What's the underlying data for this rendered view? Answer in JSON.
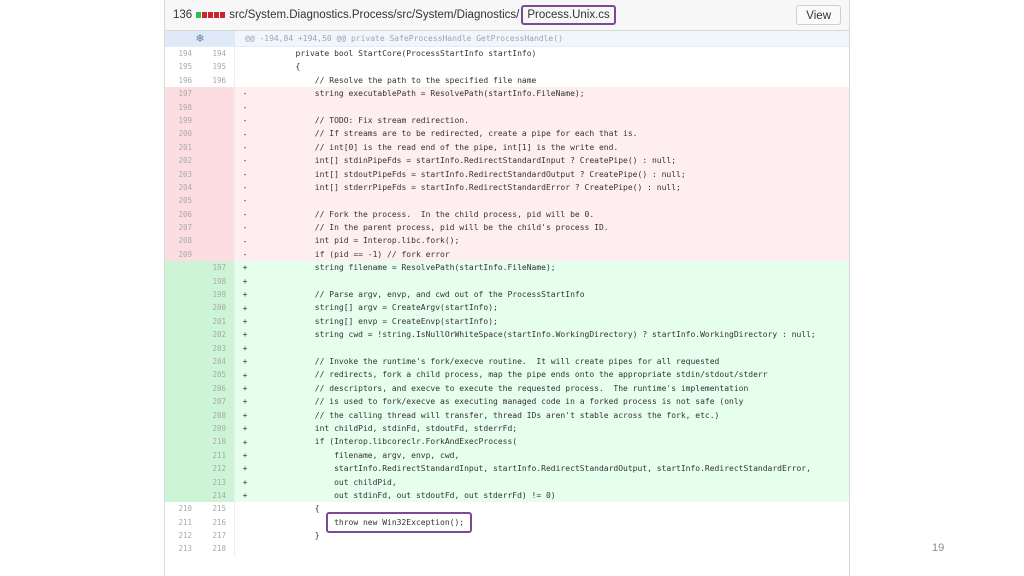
{
  "header": {
    "change_count": "136",
    "diffstat_colors": [
      "#2cbe4e",
      "#cb2431",
      "#cb2431",
      "#cb2431",
      "#cb2431"
    ],
    "path": "src/System.Diagnostics.Process/src/System/Diagnostics/",
    "file_name": "Process.Unix.cs",
    "view_label": "View"
  },
  "hunk": {
    "expander_icon": "❄",
    "text": "@@ -194,84 +194,50 @@ private SafeProcessHandle GetProcessHandle()"
  },
  "lines": [
    {
      "type": "ctx",
      "old": "194",
      "new": "194",
      "mark": "",
      "code": "        private bool StartCore(ProcessStartInfo startInfo)"
    },
    {
      "type": "ctx",
      "old": "195",
      "new": "195",
      "mark": "",
      "code": "        {"
    },
    {
      "type": "ctx",
      "old": "196",
      "new": "196",
      "mark": "",
      "code": "            // Resolve the path to the specified file name"
    },
    {
      "type": "del",
      "old": "197",
      "new": "",
      "mark": "-",
      "code": "            string executablePath = ResolvePath(startInfo.FileName);"
    },
    {
      "type": "del",
      "old": "198",
      "new": "",
      "mark": "-",
      "code": ""
    },
    {
      "type": "del",
      "old": "199",
      "new": "",
      "mark": "-",
      "code": "            // TODO: Fix stream redirection."
    },
    {
      "type": "del",
      "old": "200",
      "new": "",
      "mark": "-",
      "code": "            // If streams are to be redirected, create a pipe for each that is."
    },
    {
      "type": "del",
      "old": "201",
      "new": "",
      "mark": "-",
      "code": "            // int[0] is the read end of the pipe, int[1] is the write end."
    },
    {
      "type": "del",
      "old": "202",
      "new": "",
      "mark": "-",
      "code": "            int[] stdinPipeFds = startInfo.RedirectStandardInput ? CreatePipe() : null;"
    },
    {
      "type": "del",
      "old": "203",
      "new": "",
      "mark": "-",
      "code": "            int[] stdoutPipeFds = startInfo.RedirectStandardOutput ? CreatePipe() : null;"
    },
    {
      "type": "del",
      "old": "204",
      "new": "",
      "mark": "-",
      "code": "            int[] stderrPipeFds = startInfo.RedirectStandardError ? CreatePipe() : null;"
    },
    {
      "type": "del",
      "old": "205",
      "new": "",
      "mark": "-",
      "code": ""
    },
    {
      "type": "del",
      "old": "206",
      "new": "",
      "mark": "-",
      "code": "            // Fork the process.  In the child process, pid will be 0."
    },
    {
      "type": "del",
      "old": "207",
      "new": "",
      "mark": "-",
      "code": "            // In the parent process, pid will be the child's process ID."
    },
    {
      "type": "del",
      "old": "208",
      "new": "",
      "mark": "-",
      "code": "            int pid = Interop.libc.fork();"
    },
    {
      "type": "del",
      "old": "209",
      "new": "",
      "mark": "-",
      "code": "            if (pid == -1) // fork error"
    },
    {
      "type": "add",
      "old": "",
      "new": "197",
      "mark": "+",
      "code": "            string filename = ResolvePath(startInfo.FileName);"
    },
    {
      "type": "add",
      "old": "",
      "new": "198",
      "mark": "+",
      "code": ""
    },
    {
      "type": "add",
      "old": "",
      "new": "199",
      "mark": "+",
      "code": "            // Parse argv, envp, and cwd out of the ProcessStartInfo"
    },
    {
      "type": "add",
      "old": "",
      "new": "200",
      "mark": "+",
      "code": "            string[] argv = CreateArgv(startInfo);"
    },
    {
      "type": "add",
      "old": "",
      "new": "201",
      "mark": "+",
      "code": "            string[] envp = CreateEnvp(startInfo);"
    },
    {
      "type": "add",
      "old": "",
      "new": "202",
      "mark": "+",
      "code": "            string cwd = !string.IsNullOrWhiteSpace(startInfo.WorkingDirectory) ? startInfo.WorkingDirectory : null;"
    },
    {
      "type": "add",
      "old": "",
      "new": "203",
      "mark": "+",
      "code": ""
    },
    {
      "type": "add",
      "old": "",
      "new": "204",
      "mark": "+",
      "code": "            // Invoke the runtime's fork/execve routine.  It will create pipes for all requested"
    },
    {
      "type": "add",
      "old": "",
      "new": "205",
      "mark": "+",
      "code": "            // redirects, fork a child process, map the pipe ends onto the appropriate stdin/stdout/stderr"
    },
    {
      "type": "add",
      "old": "",
      "new": "206",
      "mark": "+",
      "code": "            // descriptors, and execve to execute the requested process.  The runtime's implementation"
    },
    {
      "type": "add",
      "old": "",
      "new": "207",
      "mark": "+",
      "code": "            // is used to fork/execve as executing managed code in a forked process is not safe (only"
    },
    {
      "type": "add",
      "old": "",
      "new": "208",
      "mark": "+",
      "code": "            // the calling thread will transfer, thread IDs aren't stable across the fork, etc.)"
    },
    {
      "type": "add",
      "old": "",
      "new": "209",
      "mark": "+",
      "code": "            int childPid, stdinFd, stdoutFd, stderrFd;"
    },
    {
      "type": "add",
      "old": "",
      "new": "210",
      "mark": "+",
      "code": "            if (Interop.libcoreclr.ForkAndExecProcess("
    },
    {
      "type": "add",
      "old": "",
      "new": "211",
      "mark": "+",
      "code": "                filename, argv, envp, cwd,"
    },
    {
      "type": "add",
      "old": "",
      "new": "212",
      "mark": "+",
      "code": "                startInfo.RedirectStandardInput, startInfo.RedirectStandardOutput, startInfo.RedirectStandardError,"
    },
    {
      "type": "add",
      "old": "",
      "new": "213",
      "mark": "+",
      "code": "                out childPid,"
    },
    {
      "type": "add",
      "old": "",
      "new": "214",
      "mark": "+",
      "code": "                out stdinFd, out stdoutFd, out stderrFd) != 0)"
    },
    {
      "type": "ctx",
      "old": "210",
      "new": "215",
      "mark": "",
      "code": "            {"
    },
    {
      "type": "ctx",
      "old": "211",
      "new": "216",
      "mark": "",
      "code": "                throw new Win32Exception();",
      "boxed": true
    },
    {
      "type": "ctx",
      "old": "212",
      "new": "217",
      "mark": "",
      "code": "            }"
    },
    {
      "type": "ctx",
      "old": "213",
      "new": "218",
      "mark": "",
      "code": ""
    }
  ],
  "slide_number": "19"
}
